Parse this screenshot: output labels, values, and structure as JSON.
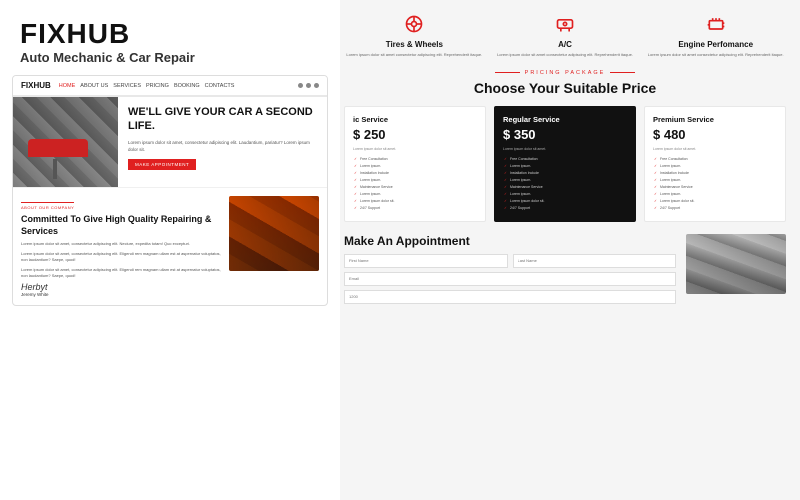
{
  "brand": {
    "name": "FIXHUB",
    "tagline": "Auto Mechanic & Car Repair"
  },
  "nav": {
    "logo": "FIXHUB",
    "links": [
      "HOME",
      "ABOUT US",
      "SERVICES",
      "PRICING",
      "BOOKING",
      "CONTACTS"
    ]
  },
  "hero": {
    "headline": "WE'LL GIVE YOUR CAR A SECOND LIFE.",
    "body": "Lorem ipsum dolor sit amet, consectetur adipiscing elit. Laudantium, pariatur? Lorem ipsum dolor sit.",
    "cta": "MAKE APPOINTMENT"
  },
  "about": {
    "label": "ABOUT OUR COMPANY",
    "heading": "Committed To Give High Quality Repairing & Services",
    "para1": "Lorem ipsum dolor sit amet, consectetur adipiscing elit. Neciure, expedita totam! Quo excepturi.",
    "para2": "Lorem ipsum dolor sit amet, consectetur adipiscing elit. Eligendi rem magnam ullam est at aspernatur voluptatos, non laudantium? Saepe, quod!",
    "para3": "Lorem ipsum dolor sit amet, consectetur adipiscing elit. Eligendi rem magnam ullam est at aspernatur voluptatos, non laudantium? Saepe, quod!",
    "signature": "Herbyt",
    "author": "Jeremy White"
  },
  "services": [
    {
      "icon": "tire",
      "title": "Tires & Wheels",
      "desc": "Lorem ipsum dolor sit amet consectetur adipiscing elit. Reprehenderit itaque."
    },
    {
      "icon": "ac",
      "title": "A/C",
      "desc": "Lorem ipsum dolor sit amet consectetur adipiscing elit. Reprehenderit itaque."
    },
    {
      "icon": "engine",
      "title": "Engine Perfomance",
      "desc": "Lorem ipsum dolor sit amet consectetur adipiscing elit. Reprehenderit itaque."
    }
  ],
  "pricing": {
    "label": "PRICING PACKAGE",
    "title": "Choose Your Suitable Price",
    "cards": [
      {
        "name": "ic Service",
        "price": "$ 250",
        "desc": "Lorem ipsum dolor sit amet.",
        "featured": false,
        "features": [
          "Free Consultation",
          "Lorem ipsum.",
          "Installation Include",
          "Lorem ipsum.",
          "Maintenance Service",
          "Lorem ipsum.",
          "Lorem ipsum dolor sit.",
          "24/7 Support"
        ]
      },
      {
        "name": "Regular Service",
        "price": "$ 350",
        "desc": "Lorem ipsum dolor sit amet.",
        "featured": true,
        "features": [
          "Free Consultation",
          "Lorem ipsum.",
          "Installation Include",
          "Lorem ipsum.",
          "Maintenance Service",
          "Lorem ipsum.",
          "Lorem ipsum dolor sit.",
          "24/7 Support"
        ]
      },
      {
        "name": "Premium Service",
        "price": "$ 480",
        "desc": "Lorem ipsum dolor sit amet.",
        "featured": false,
        "features": [
          "Free Consultation",
          "Lorem ipsum.",
          "Installation Include",
          "Lorem ipsum.",
          "Maintenance Service",
          "Lorem ipsum.",
          "Lorem ipsum dolor sit.",
          "24/7 Support"
        ]
      }
    ]
  },
  "appointment": {
    "title": "ppointment",
    "fields": [
      {
        "placeholder": "Last Name"
      },
      {
        "placeholder": "Email"
      },
      {
        "placeholder": "1200"
      }
    ]
  }
}
